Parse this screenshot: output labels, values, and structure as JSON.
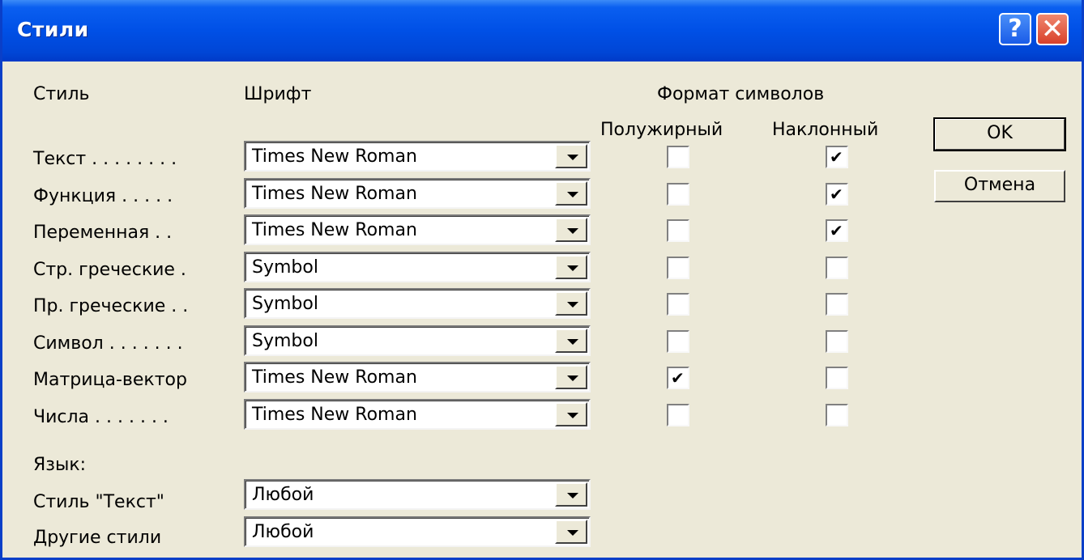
{
  "dialog": {
    "title": "Стили"
  },
  "titlebar": {
    "help": "?",
    "close": "✕"
  },
  "headers": {
    "style": "Стиль",
    "font": "Шрифт",
    "format": "Формат символов",
    "bold": "Полужирный",
    "italic": "Наклонный"
  },
  "rows": [
    {
      "label": "Текст . . . . . . . .",
      "font": "Times New Roman",
      "bold": false,
      "italic": true
    },
    {
      "label": "Функция . . . . .",
      "font": "Times New Roman",
      "bold": false,
      "italic": true
    },
    {
      "label": "Переменная . .",
      "font": "Times New Roman",
      "bold": false,
      "italic": true
    },
    {
      "label": "Стр. греческие .",
      "font": "Symbol",
      "bold": false,
      "italic": false
    },
    {
      "label": "Пр. греческие . .",
      "font": "Symbol",
      "bold": false,
      "italic": false
    },
    {
      "label": "Символ . . . . . . .",
      "font": "Symbol",
      "bold": false,
      "italic": false
    },
    {
      "label": "Матрица-вектор",
      "font": "Times New Roman",
      "bold": true,
      "italic": false
    },
    {
      "label": "Числа . . . . . . .",
      "font": "Times New Roman",
      "bold": false,
      "italic": false
    }
  ],
  "language": {
    "label": "Язык:",
    "rows": [
      {
        "label": "Стиль \"Текст\"",
        "value": "Любой"
      },
      {
        "label": "Другие стили",
        "value": "Любой"
      }
    ]
  },
  "buttons": {
    "ok": "OK",
    "cancel": "Отмена"
  },
  "icons": {
    "check": "✔",
    "help": "question-icon",
    "close": "close-icon",
    "dropdown": "chevron-down-icon"
  }
}
